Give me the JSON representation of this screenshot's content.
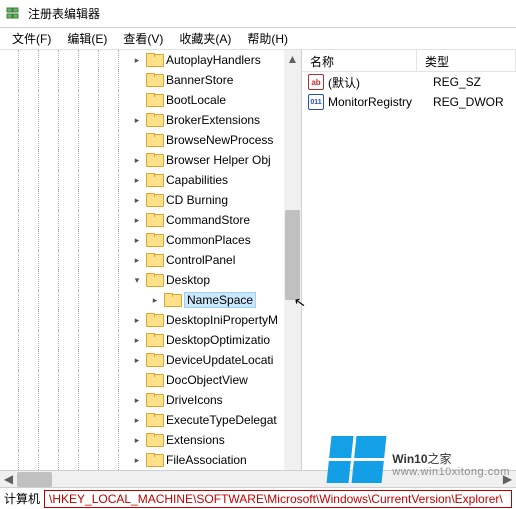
{
  "window": {
    "title": "注册表编辑器"
  },
  "menu": {
    "file": "文件(F)",
    "edit": "编辑(E)",
    "view": "查看(V)",
    "favorites": "收藏夹(A)",
    "help": "帮助(H)"
  },
  "tree": {
    "items": [
      {
        "label": "AutoplayHandlers",
        "expand": ">"
      },
      {
        "label": "BannerStore",
        "expand": ""
      },
      {
        "label": "BootLocale",
        "expand": ""
      },
      {
        "label": "BrokerExtensions",
        "expand": ">"
      },
      {
        "label": "BrowseNewProcess",
        "expand": ""
      },
      {
        "label": "Browser Helper Obj",
        "expand": ">"
      },
      {
        "label": "Capabilities",
        "expand": ">"
      },
      {
        "label": "CD Burning",
        "expand": ">"
      },
      {
        "label": "CommandStore",
        "expand": ">"
      },
      {
        "label": "CommonPlaces",
        "expand": ">"
      },
      {
        "label": "ControlPanel",
        "expand": ">"
      },
      {
        "label": "Desktop",
        "expand": "v",
        "expanded": true
      },
      {
        "label": "NameSpace",
        "expand": ">",
        "indent": 1,
        "selected": true
      },
      {
        "label": "DesktopIniPropertyM",
        "expand": ">"
      },
      {
        "label": "DesktopOptimizatio",
        "expand": ">"
      },
      {
        "label": "DeviceUpdateLocati",
        "expand": ">"
      },
      {
        "label": "DocObjectView",
        "expand": ""
      },
      {
        "label": "DriveIcons",
        "expand": ">"
      },
      {
        "label": "ExecuteTypeDelegat",
        "expand": ">"
      },
      {
        "label": "Extensions",
        "expand": ">"
      },
      {
        "label": "FileAssociation",
        "expand": ">"
      }
    ]
  },
  "list": {
    "header_name": "名称",
    "header_type": "类型",
    "rows": [
      {
        "icon": "ab",
        "name": "(默认)",
        "type": "REG_SZ"
      },
      {
        "icon": "bin",
        "name": "MonitorRegistry",
        "type": "REG_DWOR"
      }
    ]
  },
  "status": {
    "label": "计算机",
    "path": "\\HKEY_LOCAL_MACHINE\\SOFTWARE\\Microsoft\\Windows\\CurrentVersion\\Explorer\\"
  },
  "watermark": {
    "text1": "Win10",
    "text2": "之家",
    "url": "www.win10xitong.com"
  }
}
